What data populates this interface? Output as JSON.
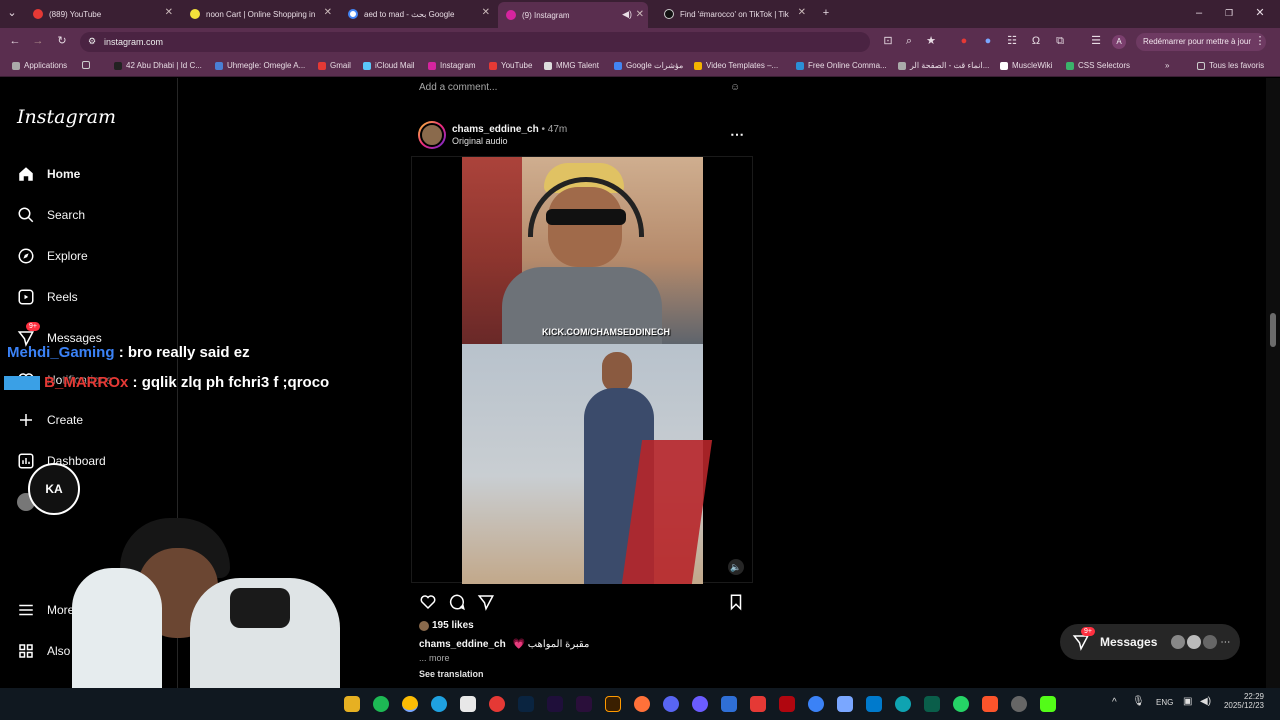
{
  "browser": {
    "tabs": [
      {
        "title": "(889) YouTube",
        "color": "#e53935"
      },
      {
        "title": "noon Cart | Online Shopping in",
        "color": "#f3e03b"
      },
      {
        "title": "aed to mad - بحث Google",
        "color": "#4285f4"
      },
      {
        "title": "(9) Instagram",
        "color": "#d6249f"
      },
      {
        "title": "Find '#marocco' on TikTok | Tik",
        "color": "#111111"
      }
    ],
    "url": "instagram.com",
    "restart_label": "Redémarrer pour mettre à jour",
    "profile_letter": "A",
    "bookmarks": [
      "Applications",
      "42 Abu Dhabi | Id C...",
      "Uhmegle: Omegle A...",
      "Gmail",
      "iCloud Mail",
      "Instagram",
      "YouTube",
      "MMG Talent",
      "Google مؤشرات",
      "Video Templates –...",
      "Free Online Comma...",
      "انماء قت - الصفحة الر...",
      "MuscleWiki",
      "CSS Selectors"
    ],
    "all_bookmarks": "Tous les favoris"
  },
  "instagram": {
    "logo": "Instagram",
    "nav": {
      "home": "Home",
      "search": "Search",
      "explore": "Explore",
      "reels": "Reels",
      "messages": "Messages",
      "messages_badge": "9+",
      "notifications": "Notifications",
      "create": "Create",
      "dashboard": "Dashboard",
      "more": "More",
      "also_from": "Also fr"
    },
    "feed": {
      "add_comment_prev": "Add a comment...",
      "post": {
        "username": "chams_eddine_ch",
        "time": "• 47m",
        "audio": "Original audio",
        "video_watermark": "KICK.COM/CHAMSEDDINECH",
        "likes": "195 likes",
        "caption_user": "chams_eddine_ch",
        "caption_text": "💗 مقبرة المواهب",
        "more": "... more",
        "see_translation": "See translation"
      }
    },
    "messages_pill": {
      "label": "Messages",
      "badge": "9+"
    }
  },
  "overlay": {
    "chat": [
      {
        "user": "Mehdi_Gaming",
        "user_color": "#3b82f6",
        "message": ": bro really said ez"
      },
      {
        "user": "B_MARROx",
        "user_color": "#e53935",
        "message": ": gqlik zlq ph fchri3 f ;qroco"
      }
    ],
    "logo_text": "KA"
  },
  "taskbar": {
    "lang": "ENG",
    "time": "22:29",
    "date": "2025/12/23"
  }
}
